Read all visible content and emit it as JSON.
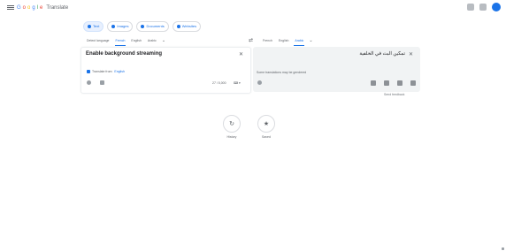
{
  "app": {
    "logo_letters": [
      "G",
      "o",
      "o",
      "g",
      "l",
      "e"
    ],
    "product": "Translate",
    "icons": [
      "apps-icon",
      "settings-icon",
      "account-avatar"
    ]
  },
  "modes": [
    {
      "label": "Text",
      "active": true
    },
    {
      "label": "Images",
      "active": false
    },
    {
      "label": "Documents",
      "active": false
    },
    {
      "label": "Websites",
      "active": false
    }
  ],
  "source_langs": [
    "Detect language",
    "French",
    "English",
    "Arabic"
  ],
  "source_selected": 1,
  "target_langs": [
    "French",
    "English",
    "Arabic"
  ],
  "target_selected": 2,
  "source": {
    "text": "Enable background streaming",
    "detected_prefix": "Translate from:",
    "detected_lang": "English",
    "char_count": "27 / 5,000",
    "keyboard": "⌨ ▾"
  },
  "target": {
    "text": "تمكين البث في الخلفية",
    "alt_note": "Some translations may be gendered",
    "feedback": "Send feedback"
  },
  "bottom": {
    "history_label": "History",
    "saved_label": "Saved",
    "history_icon": "↻",
    "saved_icon": "★"
  },
  "colors": {
    "accent": "#1a73e8",
    "panel_bg": "#f1f3f4"
  }
}
